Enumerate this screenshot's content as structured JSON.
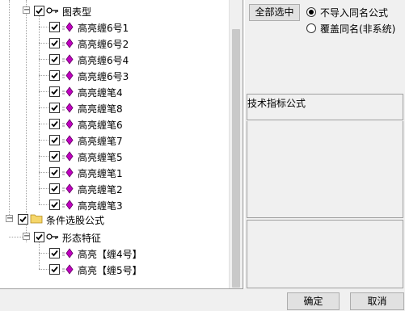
{
  "tree": {
    "nodes": [
      {
        "label": "图表型"
      },
      {
        "label": "高亮缠6号1"
      },
      {
        "label": "高亮缠6号2"
      },
      {
        "label": "高亮缠6号4"
      },
      {
        "label": "高亮缠6号3"
      },
      {
        "label": "高亮缠笔4"
      },
      {
        "label": "高亮缠笔8"
      },
      {
        "label": "高亮缠笔6"
      },
      {
        "label": "高亮缠笔7"
      },
      {
        "label": "高亮缠笔5"
      },
      {
        "label": "高亮缠笔1"
      },
      {
        "label": "高亮缠笔2"
      },
      {
        "label": "高亮缠笔3"
      },
      {
        "label": "条件选股公式"
      },
      {
        "label": "形态特征"
      },
      {
        "label": "高亮【缠4号】"
      },
      {
        "label": "高亮【缠5号】"
      }
    ],
    "expander_collapse": "−"
  },
  "actions": {
    "select_all_label": "全部选中",
    "radio_skip_label": "不导入同名公式",
    "radio_overwrite_label": "覆盖同名(非系统)",
    "selected_radio": "skip"
  },
  "info": {
    "section_title": "技术指标公式"
  },
  "footer": {
    "ok_label": "确定",
    "cancel_label": "取消"
  },
  "colors": {
    "formula_icon": "#c000c0",
    "folder_icon": "#f5d66a"
  }
}
